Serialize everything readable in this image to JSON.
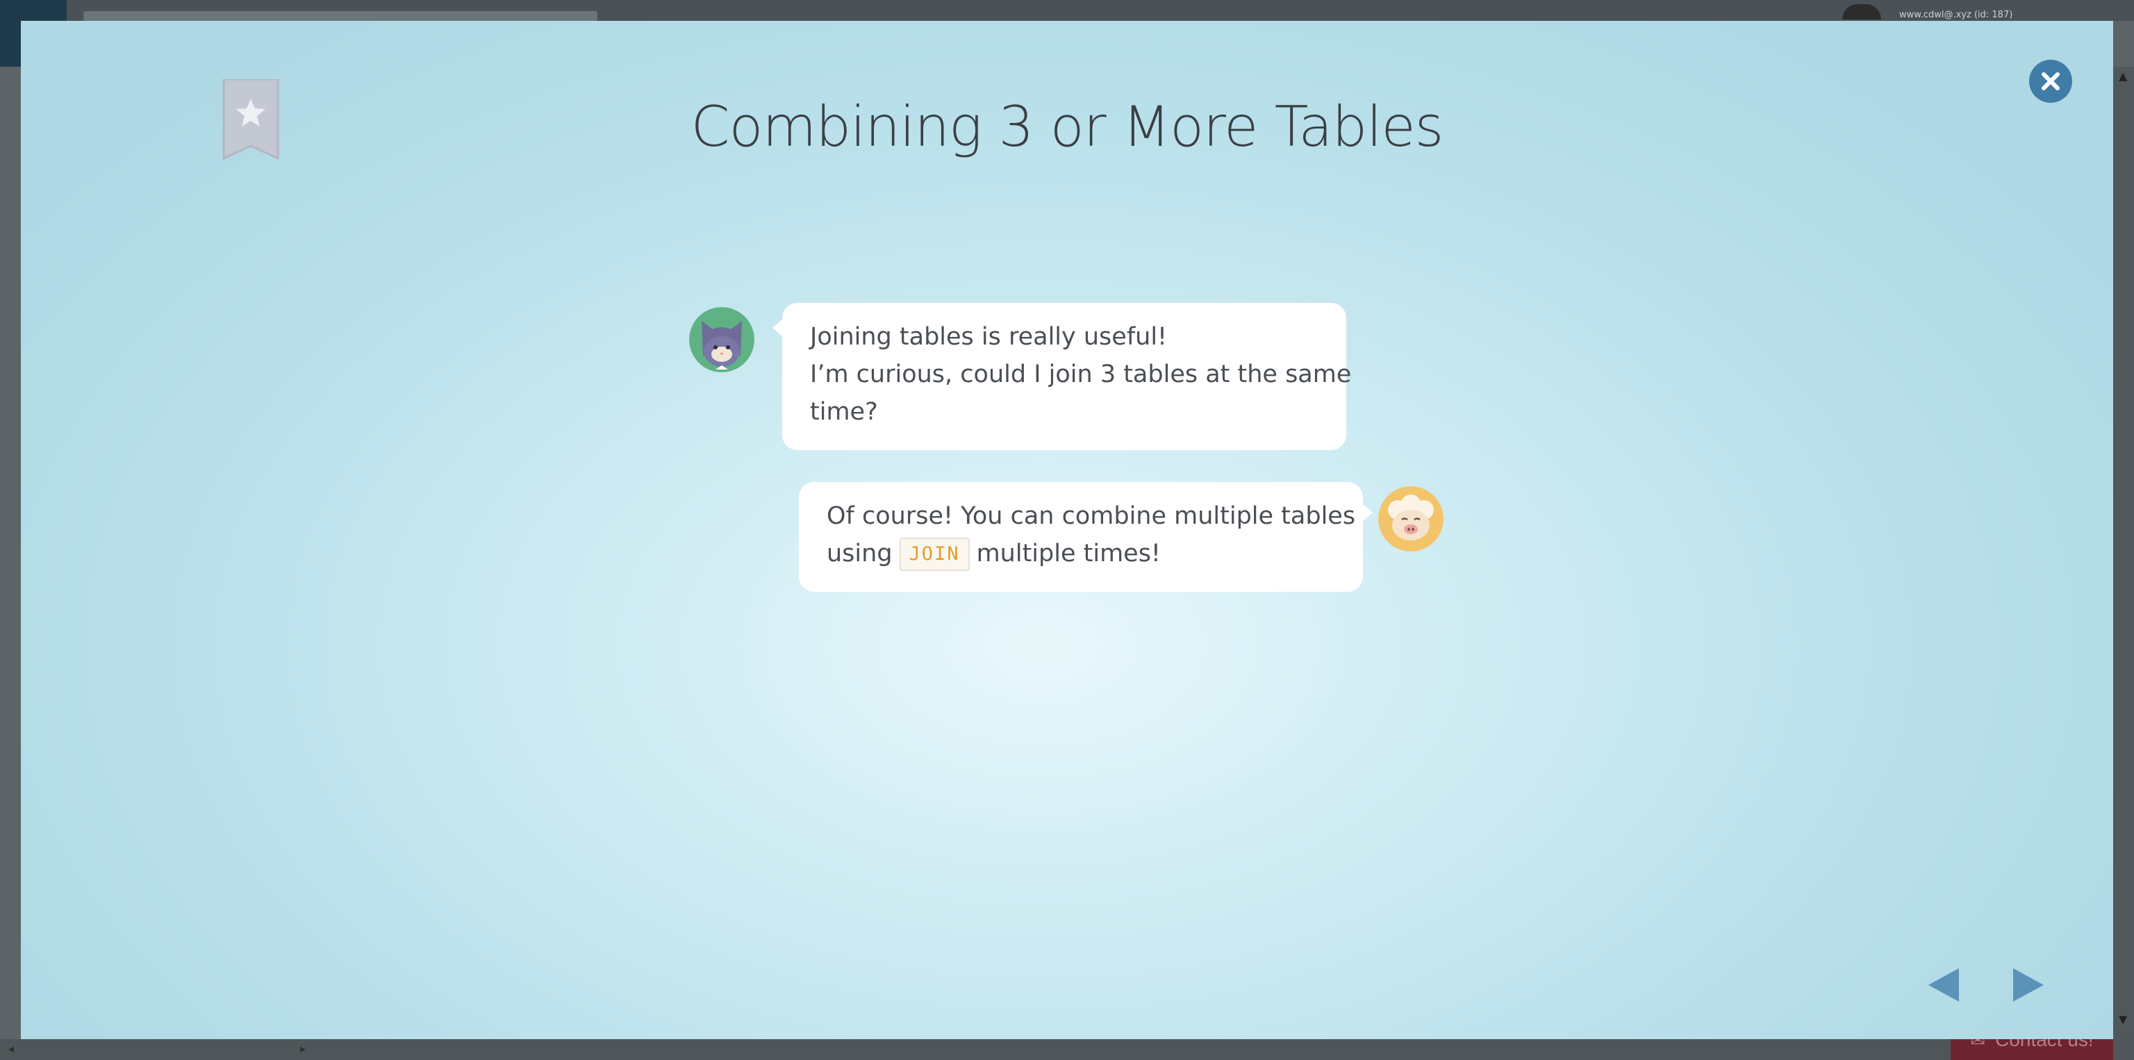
{
  "background": {
    "user_label": "www.cdwl@.xyz (id: 187)",
    "contact_label": "Contact us!"
  },
  "modal": {
    "title": "Combining 3 or More Tables",
    "close_icon": "close-icon",
    "bookmark_icon": "star-bookmark-icon",
    "messages": [
      {
        "speaker": "cat",
        "lines": [
          "Joining tables is really useful!",
          "I’m curious, could I join 3 tables at the same",
          "time?"
        ]
      },
      {
        "speaker": "sheep",
        "line1": "Of course! You can combine multiple tables",
        "line2_before": "using",
        "code": "JOIN",
        "line2_after": "multiple times!"
      }
    ],
    "nav": {
      "prev_icon": "triangle-left-icon",
      "next_icon": "triangle-right-icon"
    }
  },
  "colors": {
    "accent": "#3f7ca8",
    "nav_arrow": "#5b93b8",
    "code_text": "#e69c2c"
  }
}
